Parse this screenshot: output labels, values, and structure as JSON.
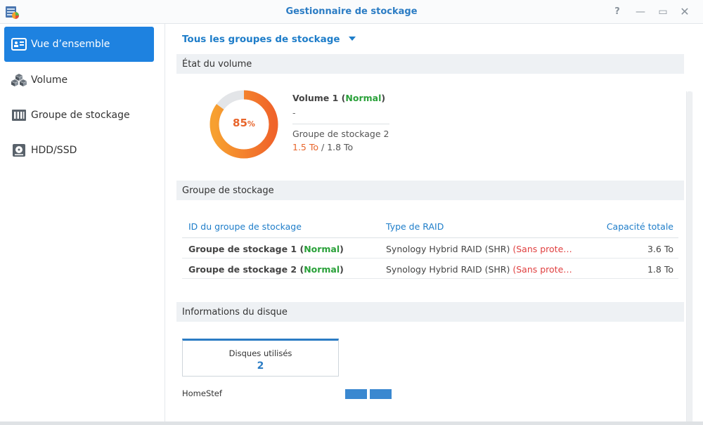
{
  "window": {
    "title": "Gestionnaire de stockage",
    "help": "?",
    "minimize": "—",
    "maximize": "▭",
    "close": "✕"
  },
  "sidebar": {
    "items": [
      {
        "label": "Vue d’ensemble",
        "icon": "overview-icon",
        "active": true
      },
      {
        "label": "Volume",
        "icon": "cubes-icon",
        "active": false
      },
      {
        "label": "Groupe de stockage",
        "icon": "storage-pool-icon",
        "active": false
      },
      {
        "label": "HDD/SSD",
        "icon": "hdd-icon",
        "active": false
      }
    ]
  },
  "main": {
    "group_selector": "Tous les groupes de stockage",
    "volume_section": {
      "title": "État du volume",
      "usage_percent": 85,
      "usage_unit": "%",
      "volume_name": "Volume 1",
      "volume_status": "Normal",
      "description": "-",
      "pool_name": "Groupe de stockage 2",
      "used": "1.5 To",
      "separator": " / ",
      "total": "1.8 To"
    },
    "pool_section": {
      "title": "Groupe de stockage",
      "columns": {
        "id": "ID du groupe de stockage",
        "raid": "Type de RAID",
        "capacity": "Capacité totale"
      },
      "rows": [
        {
          "name": "Groupe de stockage 1",
          "status": "Normal",
          "raid": "Synology Hybrid RAID (SHR)",
          "raid_note": "(Sans prote…",
          "capacity": "3.6 To"
        },
        {
          "name": "Groupe de stockage 2",
          "status": "Normal",
          "raid": "Synology Hybrid RAID (SHR)",
          "raid_note": "(Sans prote…",
          "capacity": "1.8 To"
        }
      ]
    },
    "disk_section": {
      "title": "Informations du disque",
      "disks_used_label": "Disques utilisés",
      "disks_used_value": "2",
      "host_name": "HomeStef"
    }
  },
  "colors": {
    "accent": "#1e82e0",
    "link": "#1e7dc9",
    "status_normal": "#2aa13a",
    "warning": "#e04040",
    "usage_orange": "#e8652b",
    "usage_ring_start": "#f7a030",
    "usage_ring_end": "#f0642a"
  }
}
